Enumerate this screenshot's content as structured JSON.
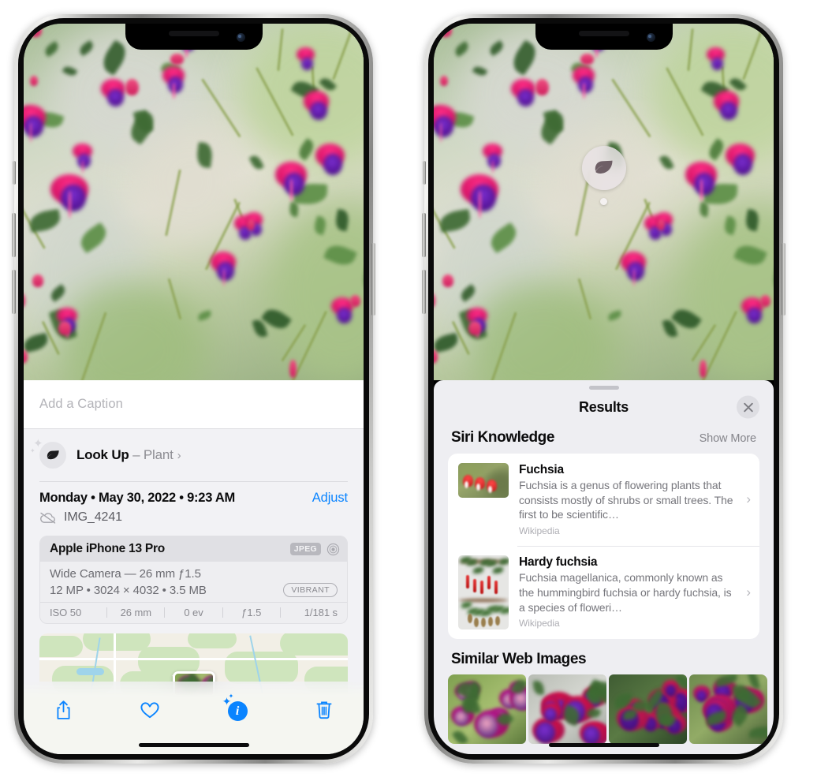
{
  "left_phone": {
    "caption_field": {
      "placeholder": "Add a Caption",
      "value": ""
    },
    "lookup_row": {
      "icon": "leaf-icon",
      "sparkle_icon": "sparkles-icon",
      "label": "Look Up",
      "separator": " – ",
      "subject": "Plant",
      "chevron": "›"
    },
    "metadata": {
      "date_line": "Monday • May 30, 2022 • 9:23 AM",
      "adjust_label": "Adjust",
      "cloud_icon": "icloud-slash-icon",
      "filename": "IMG_4241"
    },
    "camera_card": {
      "model": "Apple iPhone 13 Pro",
      "format_badge": "JPEG",
      "aperture_icon": "aperture-icon",
      "lens_line": "Wide Camera — 26 mm ƒ1.5",
      "specs_line": "12 MP • 3024 × 4032 • 3.5 MB",
      "style_badge": "VIBRANT",
      "exif": [
        "ISO 50",
        "26 mm",
        "0 ev",
        "ƒ1.5",
        "1/181 s"
      ]
    },
    "map": {
      "pin_icon": "photo-pin-thumbnail"
    },
    "toolbar": [
      {
        "name": "share-button",
        "icon": "share-icon"
      },
      {
        "name": "favorite-button",
        "icon": "heart-icon"
      },
      {
        "name": "info-button",
        "icon": "info-sparkle-icon",
        "glyph": "i"
      },
      {
        "name": "delete-button",
        "icon": "trash-icon"
      }
    ]
  },
  "right_phone": {
    "photo_badge": {
      "icon": "leaf-icon",
      "name": "visual-lookup-badge"
    },
    "results_sheet": {
      "grabber": "sheet-grabber",
      "title": "Results",
      "close_icon": "close-icon",
      "siri_section": {
        "title": "Siri Knowledge",
        "show_more": "Show More",
        "entries": [
          {
            "title": "Fuchsia",
            "description": "Fuchsia is a genus of flowering plants that consists mostly of shrubs or small trees. The first to be scientific…",
            "source": "Wikipedia",
            "chevron": "›"
          },
          {
            "title": "Hardy fuchsia",
            "description": "Fuchsia magellanica, commonly known as the hummingbird fuchsia or hardy fuchsia, is a species of floweri…",
            "source": "Wikipedia",
            "chevron": "›"
          }
        ]
      },
      "web_section": {
        "title": "Similar Web Images",
        "images": [
          "web-image-1",
          "web-image-2",
          "web-image-3",
          "web-image-4"
        ]
      }
    }
  },
  "colors": {
    "accent_blue": "#0a84ff",
    "sheet_bg": "#eeeef2",
    "card_bg": "#ffffff",
    "text_primary": "#0b0b0c",
    "text_secondary": "#76767c",
    "badge_gray": "#b8b8be"
  }
}
